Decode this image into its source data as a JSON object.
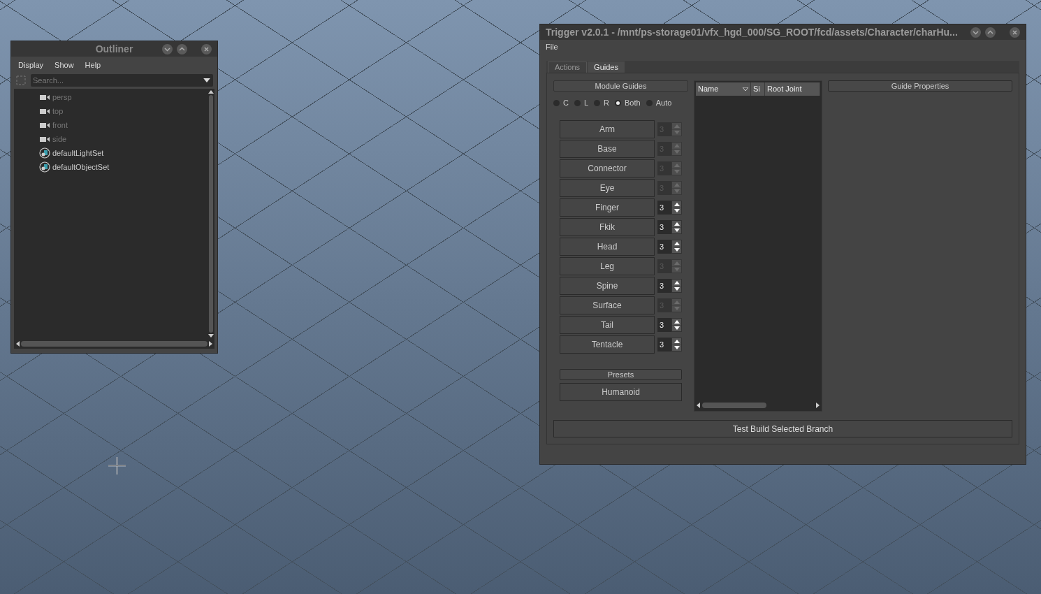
{
  "outliner": {
    "title": "Outliner",
    "menu": [
      "Display",
      "Show",
      "Help"
    ],
    "search": {
      "placeholder": "Search..."
    },
    "items": [
      {
        "label": "persp",
        "kind": "camera",
        "disabled": true
      },
      {
        "label": "top",
        "kind": "camera",
        "disabled": true
      },
      {
        "label": "front",
        "kind": "camera",
        "disabled": true
      },
      {
        "label": "side",
        "kind": "camera",
        "disabled": true
      },
      {
        "label": "defaultLightSet",
        "kind": "set",
        "disabled": false
      },
      {
        "label": "defaultObjectSet",
        "kind": "set",
        "disabled": false
      }
    ]
  },
  "trigger": {
    "title": "Trigger v2.0.1 - /mnt/ps-storage01/vfx_hgd_000/SG_ROOT/fcd/assets/Character/charHu...",
    "menu": [
      "File"
    ],
    "tabs": [
      {
        "label": "Actions",
        "selected": false
      },
      {
        "label": "Guides",
        "selected": true
      }
    ],
    "module_guides": {
      "title": "Module Guides",
      "sides": [
        {
          "label": "C",
          "selected": false
        },
        {
          "label": "L",
          "selected": false
        },
        {
          "label": "R",
          "selected": false
        },
        {
          "label": "Both",
          "selected": true
        },
        {
          "label": "Auto",
          "selected": false
        }
      ],
      "modules": [
        {
          "label": "Arm",
          "count": "3",
          "disabled": true
        },
        {
          "label": "Base",
          "count": "3",
          "disabled": true
        },
        {
          "label": "Connector",
          "count": "3",
          "disabled": true
        },
        {
          "label": "Eye",
          "count": "3",
          "disabled": true
        },
        {
          "label": "Finger",
          "count": "3",
          "disabled": false
        },
        {
          "label": "Fkik",
          "count": "3",
          "disabled": false
        },
        {
          "label": "Head",
          "count": "3",
          "disabled": false
        },
        {
          "label": "Leg",
          "count": "3",
          "disabled": true
        },
        {
          "label": "Spine",
          "count": "3",
          "disabled": false
        },
        {
          "label": "Surface",
          "count": "3",
          "disabled": true
        },
        {
          "label": "Tail",
          "count": "3",
          "disabled": false
        },
        {
          "label": "Tentacle",
          "count": "3",
          "disabled": false
        }
      ],
      "presets_title": "Presets",
      "presets": [
        "Humanoid"
      ]
    },
    "tree": {
      "columns": [
        "Name",
        "Si",
        "Root Joint"
      ]
    },
    "guide_properties": {
      "title": "Guide Properties"
    },
    "action_button": "Test Build Selected Branch"
  }
}
